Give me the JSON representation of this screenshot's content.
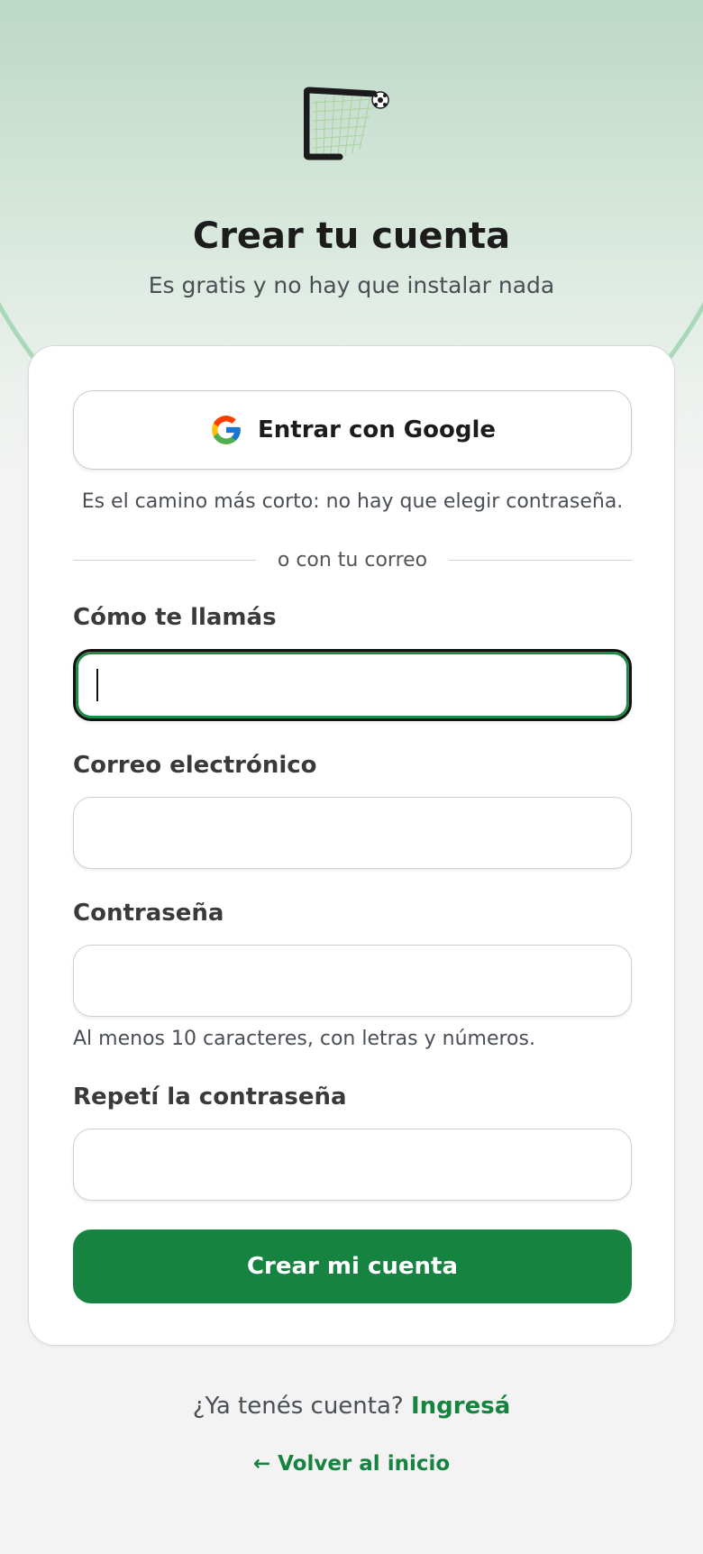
{
  "header": {
    "title": "Crear tu cuenta",
    "subtitle": "Es gratis y no hay que instalar nada",
    "logo_icon": "goal-net-with-ball-icon"
  },
  "google": {
    "button_label": "Entrar con Google",
    "hint": "Es el camino más corto: no hay que elegir contraseña."
  },
  "divider_text": "o con tu correo",
  "form": {
    "name": {
      "label": "Cómo te llamás",
      "value": "",
      "placeholder": ""
    },
    "email": {
      "label": "Correo electrónico",
      "value": "",
      "placeholder": ""
    },
    "password": {
      "label": "Contraseña",
      "value": "",
      "placeholder": "",
      "hint": "Al menos 10 caracteres, con letras y números."
    },
    "password_repeat": {
      "label": "Repetí la contraseña",
      "value": "",
      "placeholder": ""
    },
    "submit_label": "Crear mi cuenta"
  },
  "footer": {
    "have_account": "¿Ya tenés cuenta?",
    "login_link": "Ingresá",
    "back_link": "← Volver al inicio"
  },
  "colors": {
    "accent": "#168340",
    "focus_ring": "#1f8a4a",
    "hero_top": "#bcd8c7",
    "background": "#f3f3f3"
  }
}
